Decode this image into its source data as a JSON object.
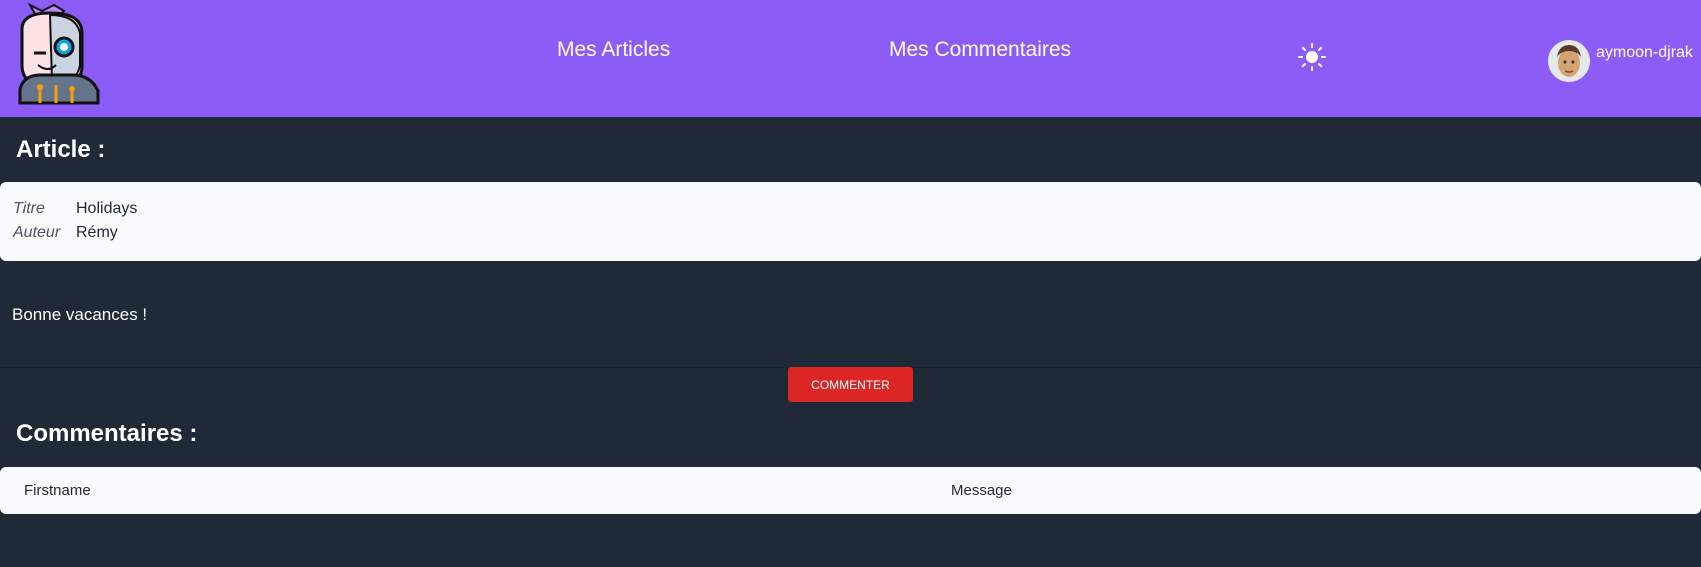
{
  "header": {
    "nav": [
      {
        "label": "Mes Articles"
      },
      {
        "label": "Mes Commentaires"
      }
    ],
    "theme_icon": "sun-icon",
    "user": {
      "name": "aymoon-djrak"
    },
    "colors": {
      "header_bg": "#8b5cf6",
      "page_bg": "#1f2937"
    }
  },
  "article": {
    "heading": "Article :",
    "meta": [
      {
        "label": "Titre",
        "value": "Holidays"
      },
      {
        "label": "Auteur",
        "value": "Rémy"
      }
    ],
    "body": "Bonne vacances !"
  },
  "actions": {
    "comment_label": "COMMENTER",
    "comment_color": "#dc2626"
  },
  "comments": {
    "heading": "Commentaires :",
    "columns": [
      "Firstname",
      "Message"
    ],
    "rows": []
  }
}
